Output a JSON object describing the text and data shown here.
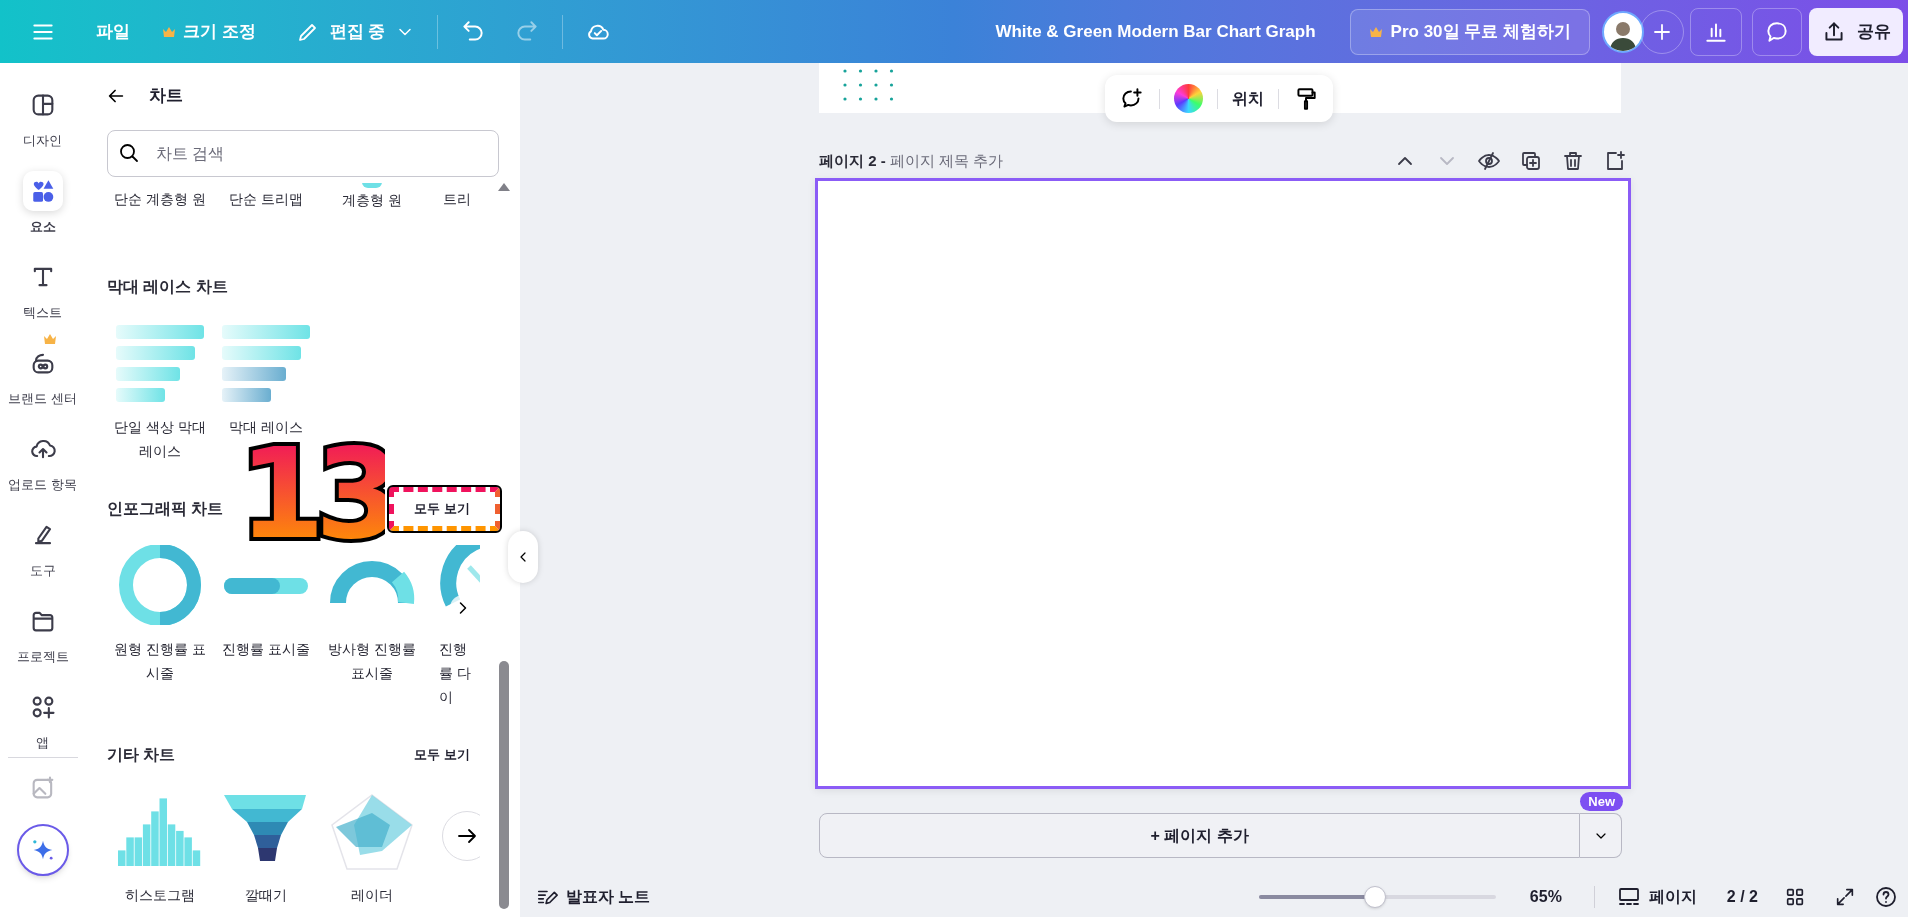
{
  "header": {
    "file": "파일",
    "resize": "크기 조정",
    "mode": "편집 중",
    "doc_title": "White & Green Modern Bar Chart Graph",
    "pro": "Pro 30일 무료 체험하기",
    "share": "공유"
  },
  "rail": [
    {
      "label": "디자인",
      "kind": "design",
      "selected": false
    },
    {
      "label": "요소",
      "kind": "elements",
      "selected": true
    },
    {
      "label": "텍스트",
      "kind": "text",
      "selected": false
    },
    {
      "label": "브랜드 센터",
      "kind": "brand",
      "selected": false
    },
    {
      "label": "업로드 항목",
      "kind": "upload",
      "selected": false
    },
    {
      "label": "도구",
      "kind": "tools",
      "selected": false
    },
    {
      "label": "프로젝트",
      "kind": "projects",
      "selected": false
    },
    {
      "label": "앱",
      "kind": "apps",
      "selected": false
    }
  ],
  "panel": {
    "title": "차트",
    "search": {
      "placeholder": "차트 검색"
    },
    "top_row": [
      "단순 계층형 원",
      "단순 트리맵",
      "계층형 원",
      "트리"
    ],
    "sections": [
      {
        "title": "막대 레이스 차트",
        "items": [
          {
            "label": "단일 색상 막대 레이스",
            "kind": "race1"
          },
          {
            "label": "막대 레이스",
            "kind": "race2"
          }
        ]
      },
      {
        "title": "인포그래픽 차트",
        "see_all": "모두 보기",
        "items": [
          {
            "label": "원형 진행률 표시줄",
            "kind": "ring"
          },
          {
            "label": "진행률 표시줄",
            "kind": "bar"
          },
          {
            "label": "방사형 진행률 표시줄",
            "kind": "radial"
          },
          {
            "label": "진행률 다이",
            "kind": "gauge"
          }
        ],
        "more": true
      },
      {
        "title": "기타 차트",
        "see_all": "모두 보기",
        "items": [
          {
            "label": "히스토그램",
            "kind": "histogram"
          },
          {
            "label": "깔때기",
            "kind": "funnel"
          },
          {
            "label": "레이더",
            "kind": "radar"
          }
        ],
        "more_round": true
      }
    ]
  },
  "annotation": {
    "step": "13"
  },
  "toolbar": {
    "position": "위치"
  },
  "page": {
    "label": "페이지 2 -",
    "title_placeholder": "페이지 제목 추가"
  },
  "add_page": {
    "label": "+ 페이지 추가",
    "badge": "New"
  },
  "footer": {
    "notes": "발표자 노트",
    "zoom": {
      "level": 0.49
    },
    "zoom_text": "65%",
    "pages": "페이지",
    "page_count": "2 / 2"
  }
}
